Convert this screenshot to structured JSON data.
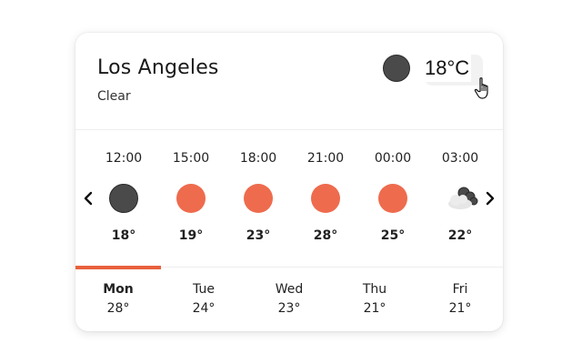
{
  "location": {
    "city": "Los Angeles",
    "condition": "Clear"
  },
  "current": {
    "temperature": "18°C",
    "icon": "moon-icon",
    "icon_color": "#4a4a4a"
  },
  "hourly": [
    {
      "time": "12:00",
      "temp": "18°",
      "icon": "moon-icon"
    },
    {
      "time": "15:00",
      "temp": "19°",
      "icon": "sun-icon"
    },
    {
      "time": "18:00",
      "temp": "23°",
      "icon": "sun-icon"
    },
    {
      "time": "21:00",
      "temp": "28°",
      "icon": "sun-icon"
    },
    {
      "time": "00:00",
      "temp": "25°",
      "icon": "sun-icon"
    },
    {
      "time": "03:00",
      "temp": "22°",
      "icon": "cloudy-night-icon"
    }
  ],
  "daily": [
    {
      "day": "Mon",
      "temp": "28°",
      "active": true
    },
    {
      "day": "Tue",
      "temp": "24°",
      "active": false
    },
    {
      "day": "Wed",
      "temp": "23°",
      "active": false
    },
    {
      "day": "Thu",
      "temp": "21°",
      "active": false
    },
    {
      "day": "Fri",
      "temp": "21°",
      "active": false
    }
  ],
  "colors": {
    "accent": "#e8603c",
    "sun": "#ee6b4d",
    "moon": "#4a4a4a",
    "cloud": "#e6e6e6"
  }
}
